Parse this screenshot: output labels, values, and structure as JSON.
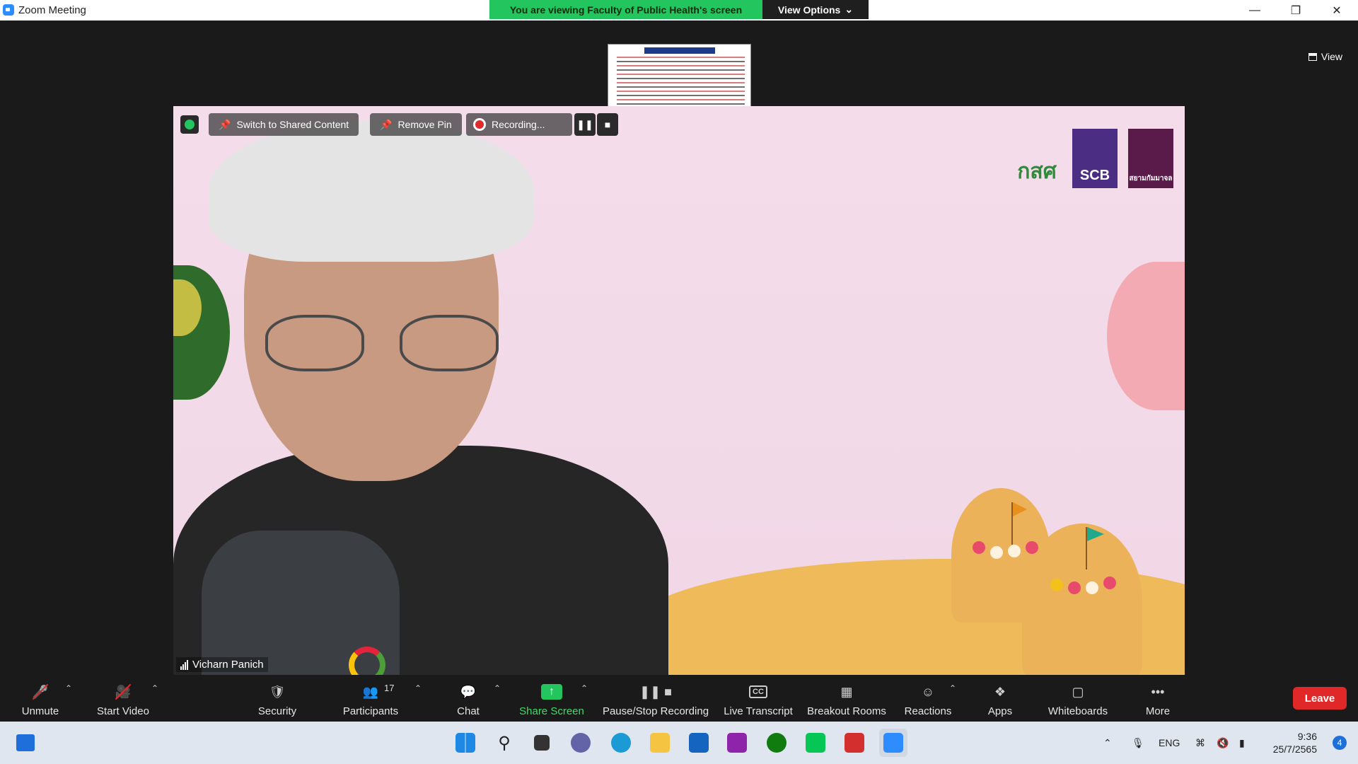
{
  "window": {
    "title": "Zoom Meeting"
  },
  "banner": {
    "viewing_text": "You are viewing Faculty of Public Health's screen",
    "view_options_label": "View Options"
  },
  "view_button": {
    "label": "View"
  },
  "overlays": {
    "switch_label": "Switch to Shared Content",
    "remove_pin_label": "Remove Pin",
    "recording_label": "Recording..."
  },
  "participant": {
    "name": "Vicharn Panich"
  },
  "logos": {
    "logo1": "กสศ",
    "logo2": "SCB",
    "logo3": "สยามกัมมาจล"
  },
  "toolbar": {
    "unmute": "Unmute",
    "start_video": "Start Video",
    "security": "Security",
    "participants": "Participants",
    "participants_count": "17",
    "chat": "Chat",
    "share_screen": "Share Screen",
    "pause_stop_recording": "Pause/Stop Recording",
    "live_transcript": "Live Transcript",
    "breakout_rooms": "Breakout Rooms",
    "reactions": "Reactions",
    "apps": "Apps",
    "whiteboards": "Whiteboards",
    "more": "More",
    "leave": "Leave"
  },
  "taskbar": {
    "language": "ENG",
    "time": "9:36",
    "date": "25/7/2565",
    "notification_count": "4"
  },
  "colors": {
    "share_green": "#22c55e",
    "leave_red": "#e02828",
    "zoom_blue": "#2d8cff"
  }
}
